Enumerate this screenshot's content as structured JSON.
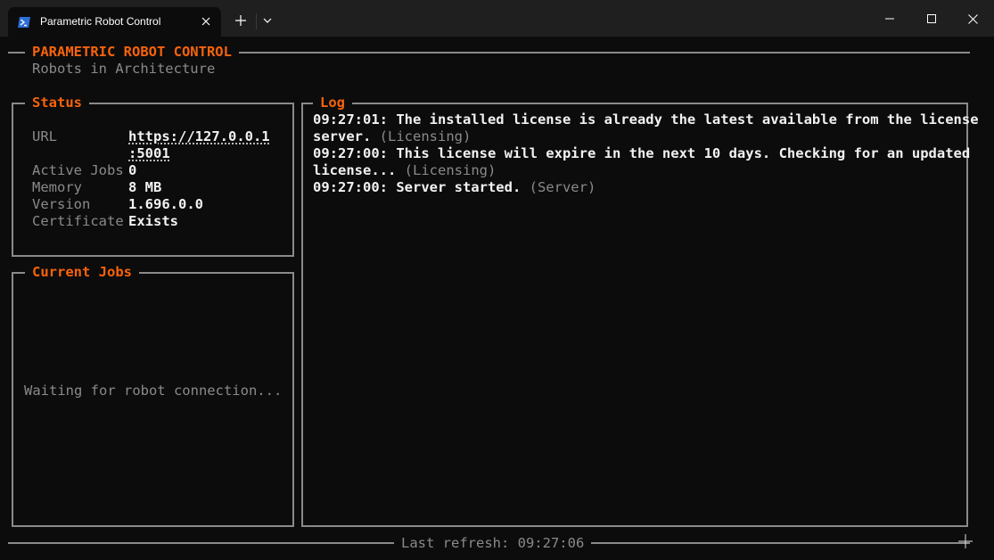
{
  "titlebar": {
    "tab_title": "Parametric Robot Control",
    "tab_icon": "powershell-icon",
    "new_tab": "+",
    "dropdown": "chevron-down-icon"
  },
  "header": {
    "title": "PARAMETRIC ROBOT CONTROL",
    "subtitle": "Robots in Architecture"
  },
  "status": {
    "legend": "Status",
    "url_label": "URL",
    "url_line1": "https://127.0.0.1",
    "url_line2": ":5001",
    "active_jobs_label": "Active Jobs",
    "active_jobs_value": "0",
    "memory_label": "Memory",
    "memory_value": "8 MB",
    "version_label": "Version",
    "version_value": "1.696.0.0",
    "certificate_label": "Certificate",
    "certificate_value": "Exists"
  },
  "jobs": {
    "legend": "Current Jobs",
    "waiting": "Waiting for robot connection..."
  },
  "log": {
    "legend": "Log",
    "lines": [
      {
        "text": "09:27:01: The installed license is already the latest available from the license",
        "tag": ""
      },
      {
        "text": "server.",
        "tag": "(Licensing)"
      },
      {
        "text": "09:27:00: This license will expire in the next 10 days. Checking for an updated",
        "tag": ""
      },
      {
        "text": "license...",
        "tag": "(Licensing)"
      },
      {
        "text": "09:27:00: Server started.",
        "tag": "(Server)"
      }
    ]
  },
  "footer": {
    "last_refresh": "Last refresh: 09:27:06"
  },
  "colors": {
    "accent": "#f7630c",
    "border": "#8a8a8a",
    "background": "#0c0c0c",
    "text": "#f2f2f2"
  }
}
